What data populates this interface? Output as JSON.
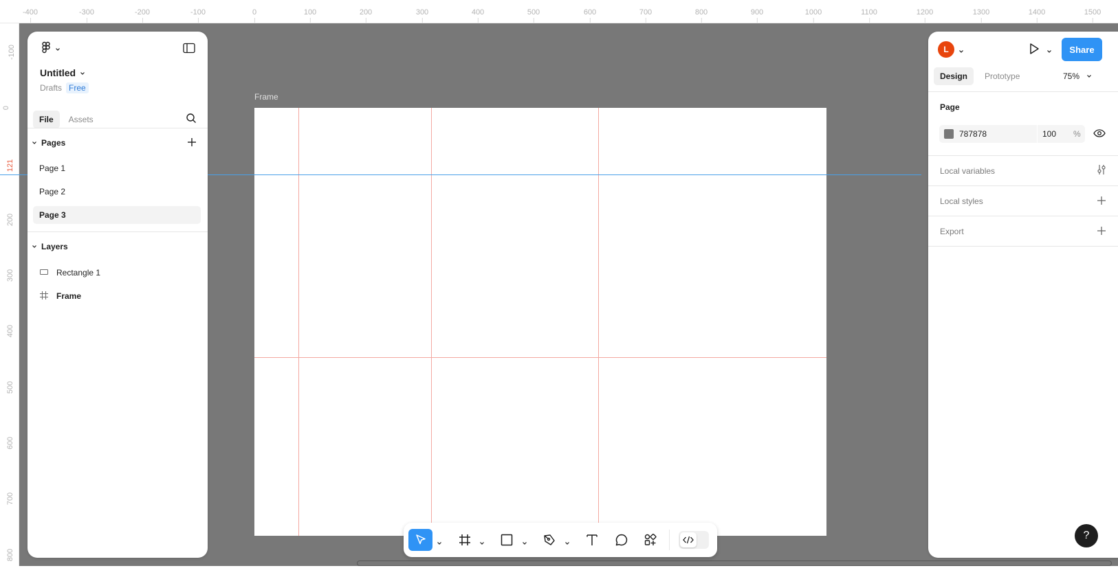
{
  "ruler": {
    "top_ticks": [
      "-400",
      "-300",
      "-200",
      "-100",
      "0",
      "100",
      "200",
      "300",
      "400",
      "500",
      "600",
      "700",
      "800",
      "900",
      "1000",
      "1100",
      "1200",
      "1300",
      "1400",
      "1500"
    ],
    "left_ticks": [
      "-100",
      "0",
      "121",
      "200",
      "300",
      "400",
      "500",
      "600",
      "700",
      "800"
    ]
  },
  "left_panel": {
    "file_name": "Untitled",
    "location": "Drafts",
    "plan_badge": "Free",
    "tabs": [
      {
        "label": "File",
        "active": true
      },
      {
        "label": "Assets",
        "active": false
      }
    ],
    "pages_header": "Pages",
    "pages": [
      {
        "label": "Page 1",
        "active": false
      },
      {
        "label": "Page 2",
        "active": false
      },
      {
        "label": "Page 3",
        "active": true
      }
    ],
    "layers_header": "Layers",
    "layers": [
      {
        "label": "Rectangle 1",
        "icon": "rectangle-icon",
        "bold": false
      },
      {
        "label": "Frame",
        "icon": "frame-icon",
        "bold": true
      }
    ]
  },
  "canvas": {
    "background": "#787878",
    "frame_label": "Frame",
    "guide_color": "#f4a7a0",
    "selection_guide_color": "#4aa0e8"
  },
  "right_panel": {
    "avatar_initial": "L",
    "avatar_color": "#e8450d",
    "share_label": "Share",
    "share_color": "#2f93f5",
    "tabs": [
      {
        "label": "Design",
        "active": true
      },
      {
        "label": "Prototype",
        "active": false
      }
    ],
    "zoom": "75%",
    "page_section": "Page",
    "fill_hex": "787878",
    "fill_opacity": "100",
    "fill_pct_sign": "%",
    "local_variables": "Local variables",
    "local_styles": "Local styles",
    "export": "Export"
  },
  "toolbar": {
    "tools": [
      "move-icon",
      "frame-tool-icon",
      "rectangle-tool-icon",
      "pen-tool-icon",
      "text-tool-icon",
      "comment-icon",
      "actions-icon"
    ],
    "active_tool": "move-icon"
  },
  "help_label": "?"
}
